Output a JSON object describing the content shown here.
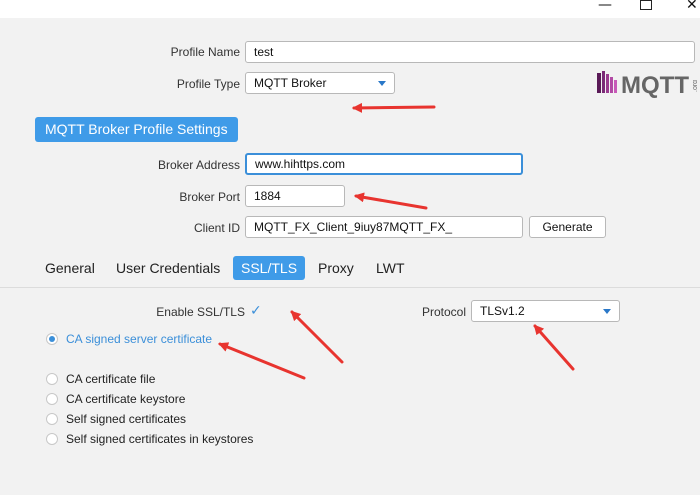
{
  "window": {
    "minimize_glyph": "—",
    "close_glyph": "✕"
  },
  "profile": {
    "name_label": "Profile Name",
    "name_value": "test",
    "type_label": "Profile Type",
    "type_value": "MQTT Broker"
  },
  "logo": {
    "text": "MQTT",
    "subtext": ".org"
  },
  "section_title": "MQTT Broker Profile Settings",
  "broker": {
    "address_label": "Broker Address",
    "address_value": "www.hihttps.com",
    "port_label": "Broker Port",
    "port_value": "1884",
    "client_id_label": "Client ID",
    "client_id_value": "MQTT_FX_Client_9iuy87MQTT_FX_",
    "generate_label": "Generate"
  },
  "tabs": [
    {
      "label": "General",
      "active": false
    },
    {
      "label": "User Credentials",
      "active": false
    },
    {
      "label": "SSL/TLS",
      "active": true
    },
    {
      "label": "Proxy",
      "active": false
    },
    {
      "label": "LWT",
      "active": false
    }
  ],
  "ssl": {
    "enable_label": "Enable SSL/TLS",
    "enable_checked": true,
    "check_glyph": "✓",
    "protocol_label": "Protocol",
    "protocol_value": "TLSv1.2"
  },
  "certificate_options": [
    {
      "label": "CA signed server certificate",
      "checked": true
    },
    {
      "label": "CA certificate file",
      "checked": false
    },
    {
      "label": "CA certificate keystore",
      "checked": false
    },
    {
      "label": "Self signed certificates",
      "checked": false
    },
    {
      "label": "Self signed certificates in keystores",
      "checked": false
    }
  ],
  "colors": {
    "accent": "#3f9be8",
    "annotation_arrow": "#e8342f"
  }
}
